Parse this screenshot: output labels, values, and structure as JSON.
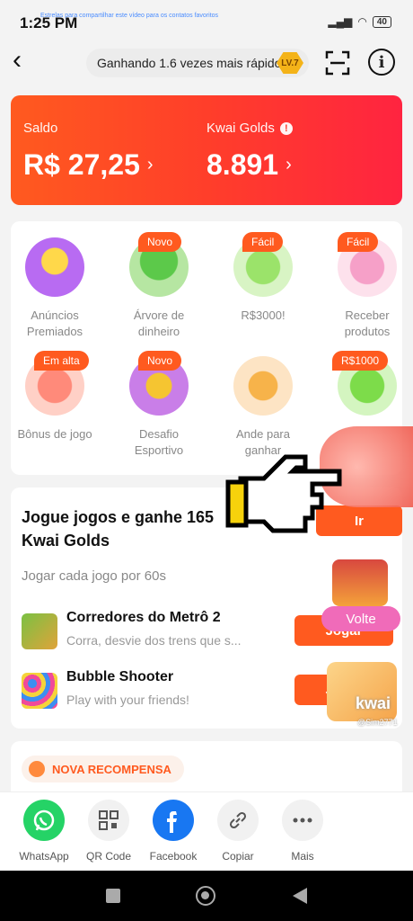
{
  "status": {
    "time": "1:25 PM",
    "ticker": "Estrelas para compartilhar este vídeo para os contatos favoritos",
    "battery": "40"
  },
  "topbar": {
    "speed_text": "Ganhando 1.6 vezes mais rápido",
    "level": "LV.7"
  },
  "balance": {
    "saldo_label": "Saldo",
    "saldo_value": "R$ 27,25",
    "golds_label": "Kwai Golds",
    "golds_value": "8.891"
  },
  "tasks": [
    {
      "label": "Anúncios Premiados",
      "tag": ""
    },
    {
      "label": "Árvore de dinheiro",
      "tag": "Novo"
    },
    {
      "label": "R$3000!",
      "tag": "Fácil"
    },
    {
      "label": "Receber produtos",
      "tag": "Fácil"
    },
    {
      "label": "Bônus de jogo",
      "tag": "Em alta"
    },
    {
      "label": "Desafio Esportivo",
      "tag": "Novo"
    },
    {
      "label": "Ande para ganhar",
      "tag": ""
    },
    {
      "label": "",
      "tag": "R$1000"
    }
  ],
  "games": {
    "title": "Jogue jogos e ganhe 165 Kwai Golds",
    "subtitle": "Jogar cada jogo por 60s",
    "go_button": "Ir",
    "items": [
      {
        "name": "Corredores do Metrô 2",
        "desc": "Corra, desvie dos trens que s...",
        "button": "Jogar"
      },
      {
        "name": "Bubble Shooter",
        "desc": "Play with your friends!",
        "button": "Jogar"
      }
    ]
  },
  "reward": {
    "label": "NOVA RECOMPENSA"
  },
  "floating": {
    "volte": "Volte",
    "kwai": "kwai",
    "kwai_id": "@Sim2771"
  },
  "share": [
    {
      "label": "WhatsApp",
      "icon": "whatsapp-icon",
      "color": "#25d366"
    },
    {
      "label": "QR Code",
      "icon": "qr-code-icon",
      "color": "#f1f1f1"
    },
    {
      "label": "Facebook",
      "icon": "facebook-icon",
      "color": "#1877f2"
    },
    {
      "label": "Copiar",
      "icon": "link-icon",
      "color": "#f1f1f1"
    },
    {
      "label": "Mais",
      "icon": "more-icon",
      "color": "#f1f1f1"
    }
  ],
  "colors": {
    "accent": "#ff5a1f",
    "card_gradient_start": "#ff5a1f",
    "card_gradient_end": "#ff2440"
  }
}
